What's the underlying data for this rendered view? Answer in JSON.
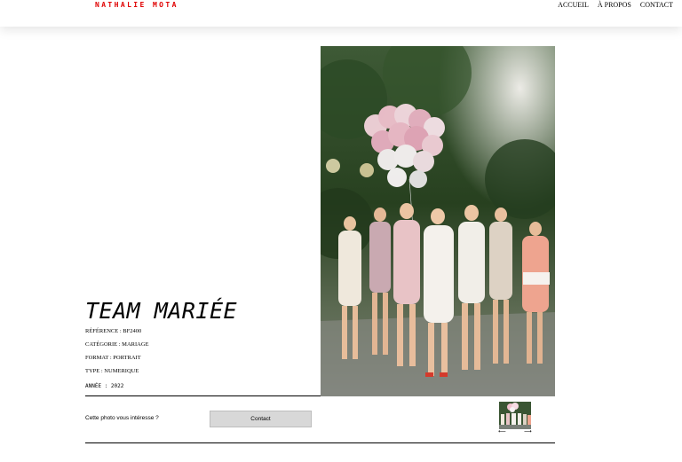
{
  "header": {
    "logo": "NATHALIE MOTA",
    "nav": [
      "ACCUEIL",
      "À PROPOS",
      "CONTACT"
    ]
  },
  "photo": {
    "title": "TEAM MARIÉE",
    "reference": "RÉFÉRENCE : BF2400",
    "category": "CATÉGORIE : MARIAGE",
    "format": "FORMAT : PORTRAIT",
    "type": "TYPE : NUMERIQUE",
    "year": "ANNÉE : 2022"
  },
  "contact": {
    "question": "Cette photo vous intéresse ?",
    "button_label": "Contact"
  },
  "navigation": {
    "prev_arrow": "⟵",
    "next_arrow": "⟶"
  },
  "colors": {
    "logo_red": "#e00000",
    "button_gray": "#d8d8d8"
  }
}
